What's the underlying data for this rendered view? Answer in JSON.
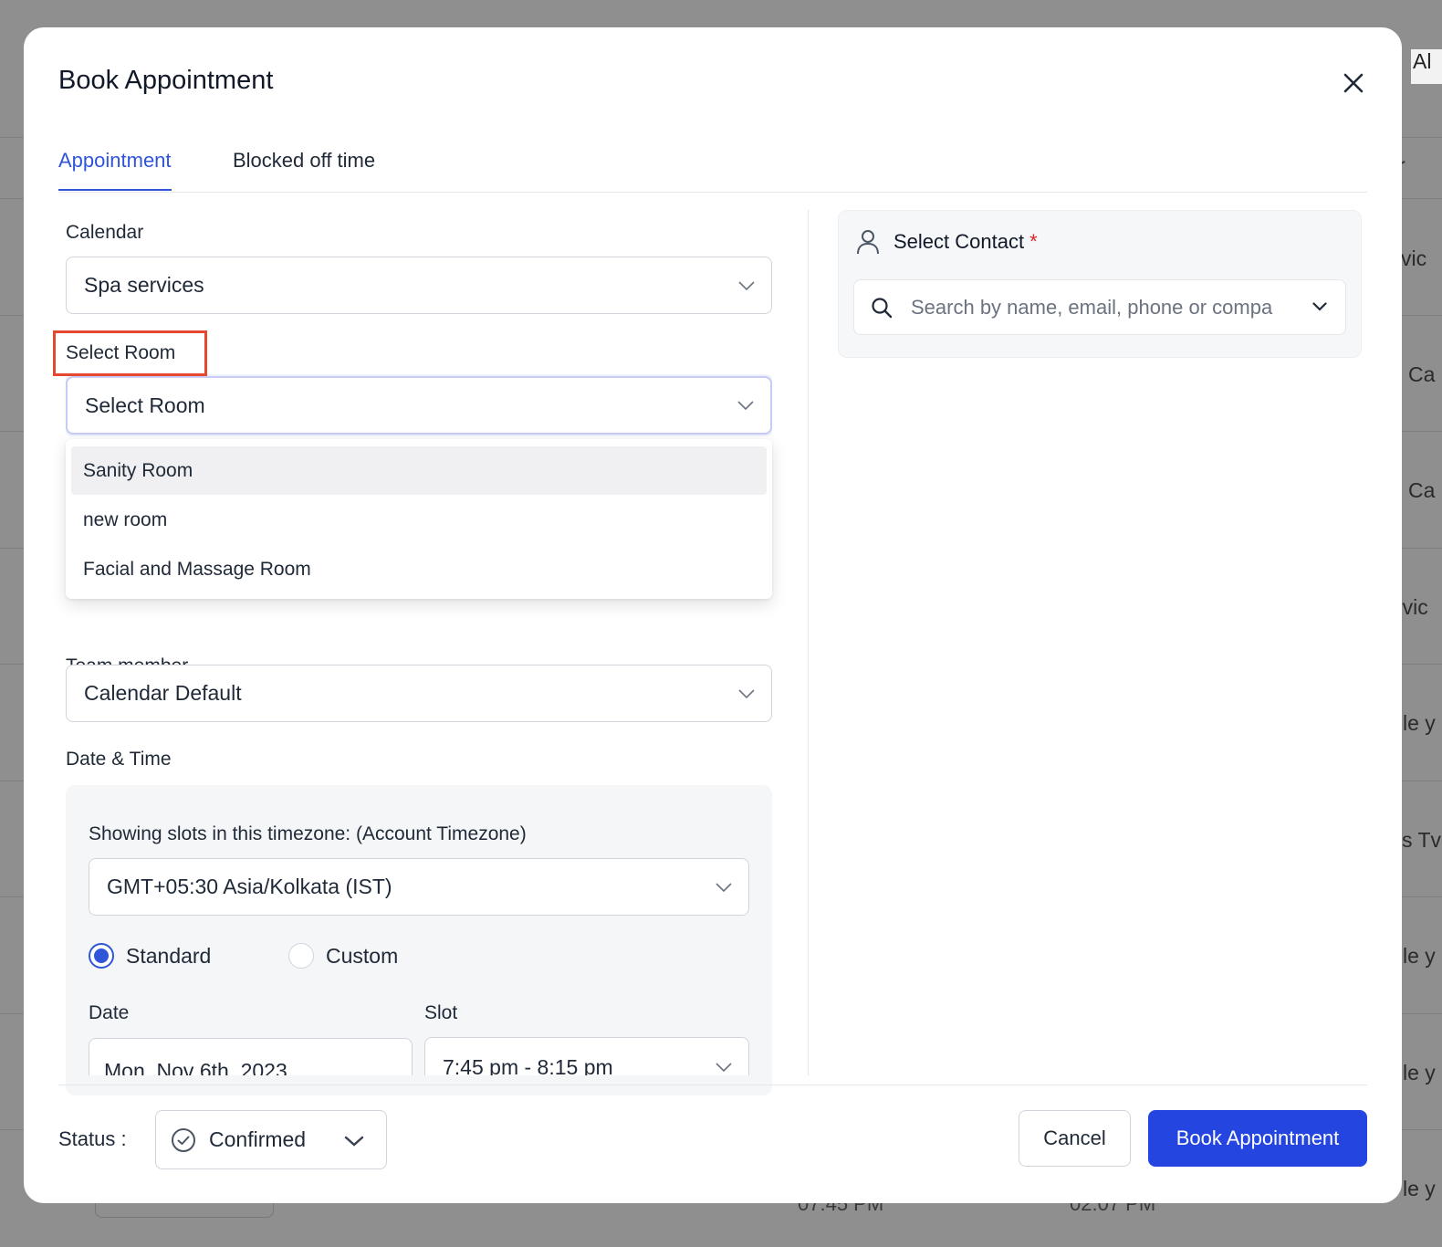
{
  "background": {
    "fragments": [
      "Al",
      "r",
      "vic",
      "Ca",
      "Ca",
      "rvic",
      "le y",
      "s Tv",
      "le y",
      "le y",
      "le y"
    ],
    "bottom_times": [
      "07:45 PM",
      "02:07 PM"
    ]
  },
  "modal": {
    "title": "Book Appointment",
    "close_icon": "close-icon",
    "tabs": [
      {
        "label": "Appointment",
        "active": true
      },
      {
        "label": "Blocked off time",
        "active": false
      }
    ]
  },
  "calendar": {
    "label": "Calendar",
    "value": "Spa services"
  },
  "room": {
    "label": "Select Room",
    "placeholder": "Select Room",
    "options": [
      "Sanity Room",
      "new room",
      "Facial and Massage Room"
    ],
    "hovered_option": "Sanity Room"
  },
  "team_member": {
    "label": "Team member",
    "value": "Calendar Default"
  },
  "date_time": {
    "label": "Date & Time",
    "timezone_label": "Showing slots in this timezone: (Account Timezone)",
    "timezone_value": "GMT+05:30 Asia/Kolkata (IST)",
    "mode_options": [
      {
        "label": "Standard",
        "checked": true
      },
      {
        "label": "Custom",
        "checked": false
      }
    ],
    "date_label": "Date",
    "date_value": "Mon, Nov 6th, 2023",
    "slot_label": "Slot",
    "slot_value": "7:45 pm - 8:15 pm"
  },
  "contact": {
    "title": "Select Contact",
    "required_mark": "*",
    "search_placeholder": "Search by name, email, phone or compa"
  },
  "footer": {
    "status_label": "Status :",
    "status_value": "Confirmed",
    "cancel_label": "Cancel",
    "book_label": "Book Appointment"
  },
  "colors": {
    "accent": "#2f56d9",
    "primary_button": "#2445e0",
    "highlight_box": "#e4482f",
    "required": "#dc2626"
  }
}
